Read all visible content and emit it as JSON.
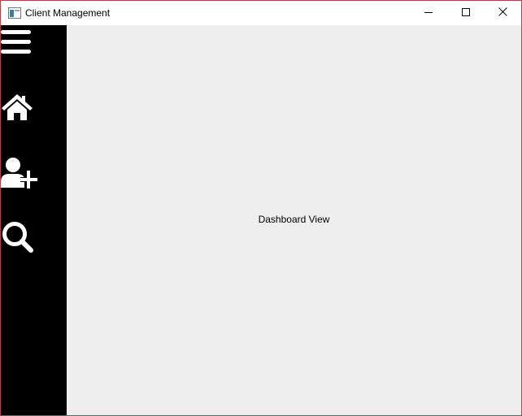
{
  "window": {
    "title": "Client Management",
    "controls": {
      "minimize_icon": "minimize-icon",
      "maximize_icon": "maximize-icon",
      "close_icon": "close-icon"
    },
    "border_color": "#a9474f"
  },
  "sidebar": {
    "background": "#000000",
    "items": [
      {
        "icon": "hamburger-menu-icon"
      },
      {
        "icon": "home-icon"
      },
      {
        "icon": "add-user-icon"
      },
      {
        "icon": "search-icon"
      }
    ]
  },
  "main": {
    "view_label": "Dashboard View",
    "background": "#eeeeee"
  }
}
